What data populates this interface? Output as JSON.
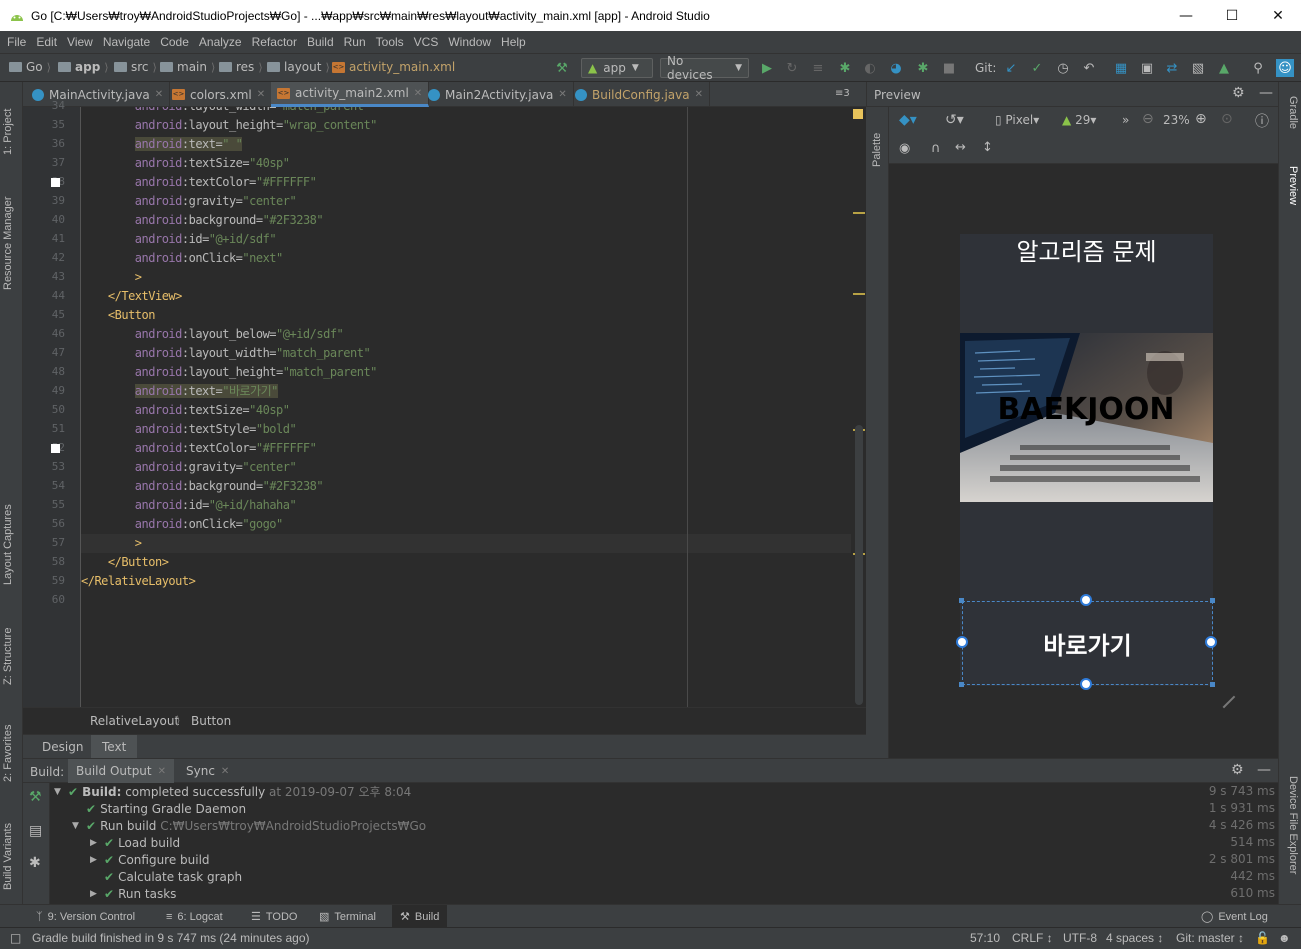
{
  "window": {
    "title": "Go [C:₩Users₩troy₩AndroidStudioProjects₩Go] - ...₩app₩src₩main₩res₩layout₩activity_main.xml [app] - Android Studio"
  },
  "menu": [
    "File",
    "Edit",
    "View",
    "Navigate",
    "Code",
    "Analyze",
    "Refactor",
    "Build",
    "Run",
    "Tools",
    "VCS",
    "Window",
    "Help"
  ],
  "nav": {
    "crumbs": [
      "Go",
      "app",
      "src",
      "main",
      "res",
      "layout",
      "activity_main.xml"
    ],
    "run_config": "app",
    "device": "No devices",
    "git_label": "Git:"
  },
  "tabs": [
    {
      "label": "MainActivity.java",
      "icon": "java-class-icon"
    },
    {
      "label": "colors.xml",
      "icon": "xml-file-icon"
    },
    {
      "label": "activity_main2.xml",
      "icon": "xml-file-icon"
    },
    {
      "label": "Main2Activity.java",
      "icon": "java-class-icon"
    },
    {
      "label": "BuildConfig.java",
      "icon": "java-class-icon"
    }
  ],
  "tabs_overflow": "≡3",
  "left_tools": [
    "1: Project",
    "Resource Manager",
    "Layout Captures",
    "Z: Structure",
    "2: Favorites",
    "Build Variants"
  ],
  "right_tools": [
    "Gradle",
    "Preview",
    "Device File Explorer"
  ],
  "palette_label": "Palette",
  "editor": {
    "line_numbers": [
      "34",
      "35",
      "36",
      "37",
      "38",
      "39",
      "40",
      "41",
      "42",
      "43",
      "44",
      "45",
      "46",
      "47",
      "48",
      "49",
      "50",
      "51",
      "52",
      "53",
      "54",
      "55",
      "56",
      "57",
      "58",
      "59",
      "60"
    ],
    "lines": [
      {
        "indent": "        ",
        "ns": "android",
        "attr": ":layout_width",
        "eq": "=",
        "val": "\"match_parent\"",
        "hl": false
      },
      {
        "indent": "        ",
        "ns": "android",
        "attr": ":layout_height",
        "eq": "=",
        "val": "\"wrap_content\"",
        "hl": false
      },
      {
        "indent": "        ",
        "ns": "android",
        "attr": ":text",
        "eq": "=",
        "val": "\" \"",
        "hl": true
      },
      {
        "indent": "        ",
        "ns": "android",
        "attr": ":textSize",
        "eq": "=",
        "val": "\"40sp\"",
        "hl": false
      },
      {
        "indent": "        ",
        "ns": "android",
        "attr": ":textColor",
        "eq": "=",
        "val": "\"#FFFFFF\"",
        "hl": false
      },
      {
        "indent": "        ",
        "ns": "android",
        "attr": ":gravity",
        "eq": "=",
        "val": "\"center\"",
        "hl": false
      },
      {
        "indent": "        ",
        "ns": "android",
        "attr": ":background",
        "eq": "=",
        "val": "\"#2F3238\"",
        "hl": false
      },
      {
        "indent": "        ",
        "ns": "android",
        "attr": ":id",
        "eq": "=",
        "val": "\"@+id/sdf\"",
        "hl": false
      },
      {
        "indent": "        ",
        "ns": "android",
        "attr": ":onClick",
        "eq": "=",
        "val": "\"next\"",
        "hl": false
      },
      {
        "indent": "        ",
        "tag": ">",
        "hl": false
      },
      {
        "indent": "    ",
        "tag": "</TextView>",
        "hl": false
      },
      {
        "indent": "    ",
        "tag": "<Button",
        "hl": false
      },
      {
        "indent": "        ",
        "ns": "android",
        "attr": ":layout_below",
        "eq": "=",
        "val": "\"@+id/sdf\"",
        "hl": false
      },
      {
        "indent": "        ",
        "ns": "android",
        "attr": ":layout_width",
        "eq": "=",
        "val": "\"match_parent\"",
        "hl": false
      },
      {
        "indent": "        ",
        "ns": "android",
        "attr": ":layout_height",
        "eq": "=",
        "val": "\"match_parent\"",
        "hl": false
      },
      {
        "indent": "        ",
        "ns": "android",
        "attr": ":text",
        "eq": "=",
        "val": "\"바로가기\"",
        "hl": true
      },
      {
        "indent": "        ",
        "ns": "android",
        "attr": ":textSize",
        "eq": "=",
        "val": "\"40sp\"",
        "hl": false
      },
      {
        "indent": "        ",
        "ns": "android",
        "attr": ":textStyle",
        "eq": "=",
        "val": "\"bold\"",
        "hl": false
      },
      {
        "indent": "        ",
        "ns": "android",
        "attr": ":textColor",
        "eq": "=",
        "val": "\"#FFFFFF\"",
        "hl": false
      },
      {
        "indent": "        ",
        "ns": "android",
        "attr": ":gravity",
        "eq": "=",
        "val": "\"center\"",
        "hl": false
      },
      {
        "indent": "        ",
        "ns": "android",
        "attr": ":background",
        "eq": "=",
        "val": "\"#2F3238\"",
        "hl": false
      },
      {
        "indent": "        ",
        "ns": "android",
        "attr": ":id",
        "eq": "=",
        "val": "\"@+id/hahaha\"",
        "hl": false
      },
      {
        "indent": "        ",
        "ns": "android",
        "attr": ":onClick",
        "eq": "=",
        "val": "\"gogo\"",
        "hl": false
      },
      {
        "indent": "        ",
        "tag": ">",
        "hl": false
      },
      {
        "indent": "    ",
        "tag": "</Button>",
        "hl": false
      },
      {
        "indent": "",
        "tag": "</RelativeLayout>",
        "hl": false
      },
      {
        "indent": "",
        "tag": "",
        "hl": false
      }
    ],
    "color_swatches_at": [
      "38",
      "52"
    ],
    "breadcrumb": [
      "RelativeLayout",
      "Button"
    ],
    "mode_tabs": [
      "Design",
      "Text"
    ],
    "active_mode": "Text"
  },
  "preview": {
    "title": "Preview",
    "device_label": "Pixel",
    "api_label": "29",
    "zoom": "23%",
    "app_title": "알고리즘 문제",
    "image_text": "BAEKJOON",
    "button_text": "바로가기",
    "background_color": "#2F3238"
  },
  "build": {
    "tab_prefix": "Build:",
    "tabs": [
      "Build Output",
      "Sync"
    ],
    "rows": [
      {
        "level": 0,
        "expanded": true,
        "bold": "Build:",
        "text": " completed successfully",
        "muted": " at 2019-09-07 오후 8:04",
        "time": "9 s 743 ms"
      },
      {
        "level": 1,
        "expanded": null,
        "bold": "",
        "text": "Starting Gradle Daemon",
        "muted": "",
        "time": "1 s 931 ms"
      },
      {
        "level": 1,
        "expanded": true,
        "bold": "",
        "text": "Run build",
        "muted": " C:₩Users₩troy₩AndroidStudioProjects₩Go",
        "time": "4 s 426 ms"
      },
      {
        "level": 2,
        "expanded": false,
        "bold": "",
        "text": "Load build",
        "muted": "",
        "time": "514 ms"
      },
      {
        "level": 2,
        "expanded": false,
        "bold": "",
        "text": "Configure build",
        "muted": "",
        "time": "2 s 801 ms"
      },
      {
        "level": 2,
        "expanded": null,
        "bold": "",
        "text": "Calculate task graph",
        "muted": "",
        "time": "442 ms"
      },
      {
        "level": 2,
        "expanded": false,
        "bold": "",
        "text": "Run tasks",
        "muted": "",
        "time": "610 ms"
      }
    ]
  },
  "bottom_tools": [
    {
      "label": "9: Version Control",
      "icon": "branch-icon"
    },
    {
      "label": "6: Logcat",
      "icon": "logcat-icon"
    },
    {
      "label": "TODO",
      "icon": "todo-icon"
    },
    {
      "label": "Terminal",
      "icon": "terminal-icon"
    },
    {
      "label": "Build",
      "icon": "hammer-icon"
    }
  ],
  "event_log": "Event Log",
  "status": {
    "message": "Gradle build finished in 9 s 747 ms (24 minutes ago)",
    "position": "57:10",
    "line_sep": "CRLF ↕",
    "encoding": "UTF-8",
    "indent": "4 spaces ↕",
    "git": "Git: master ↕"
  }
}
